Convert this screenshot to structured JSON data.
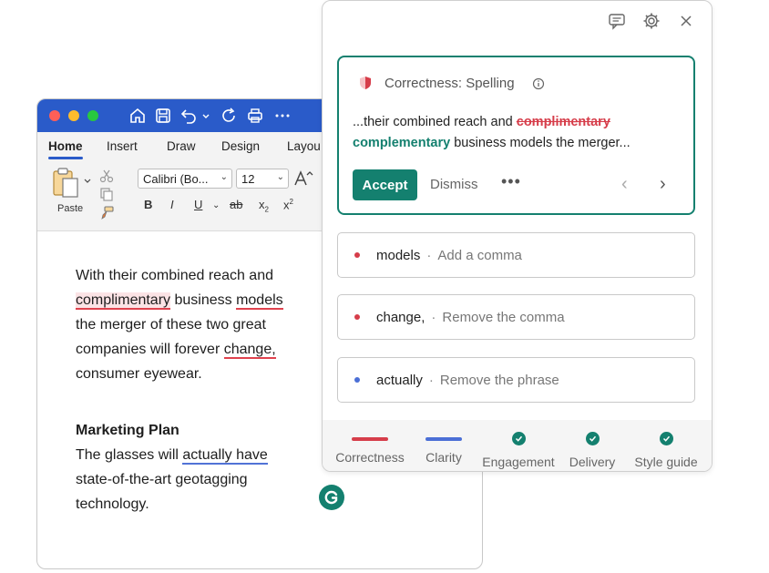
{
  "word": {
    "ribbon_tabs": [
      "Home",
      "Insert",
      "Draw",
      "Design",
      "Layou"
    ],
    "paste_label": "Paste",
    "font_name": "Calibri (Bo...",
    "font_size": "12",
    "format_buttons": [
      "B",
      "I",
      "U",
      "ab",
      "x",
      "x"
    ],
    "doc": {
      "p1_a": "With their combined reach and",
      "p1_flag": "complimentary",
      "p1_b": " business ",
      "p1_models": "models",
      "p1_c": "the merger of these two great",
      "p1_d": "companies will forever ",
      "p1_change": "change,",
      "p1_e": "consumer eyewear.",
      "heading": "Marketing Plan",
      "p2_a": "The glasses will ",
      "p2_actually": "actually have",
      "p2_b": "state-of-the-art geotagging",
      "p2_c": "technology."
    }
  },
  "grammarly": {
    "card": {
      "title": "Correctness: Spelling",
      "text_before": "...their combined reach and ",
      "strike_word": "complimentary",
      "replacement": "complementary",
      "text_after": " business models the merger...",
      "accept_label": "Accept",
      "dismiss_label": "Dismiss",
      "more_label": "•••"
    },
    "suggestions": [
      {
        "word": "models",
        "hint": "Add a comma",
        "color": "#d63d4a"
      },
      {
        "word": "change,",
        "hint": "Remove the comma",
        "color": "#d63d4a"
      },
      {
        "word": "actually",
        "hint": "Remove the phrase",
        "color": "#4b6fd6"
      }
    ],
    "separator": "·",
    "categories": [
      {
        "label": "Correctness",
        "indicator": "bar",
        "color": "#d63d4a"
      },
      {
        "label": "Clarity",
        "indicator": "bar",
        "color": "#4b6fd6"
      },
      {
        "label": "Engagement",
        "indicator": "check",
        "color": "#14806f"
      },
      {
        "label": "Delivery",
        "indicator": "check",
        "color": "#14806f"
      },
      {
        "label": "Style guide",
        "indicator": "check",
        "color": "#14806f"
      }
    ]
  }
}
